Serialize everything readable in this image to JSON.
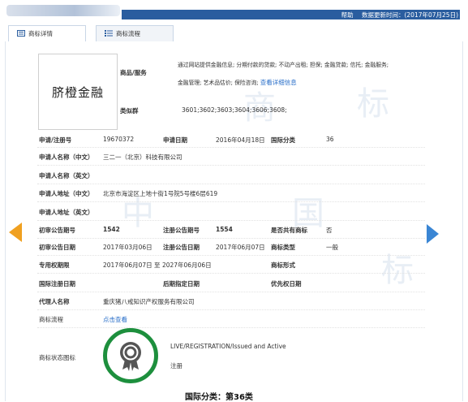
{
  "header": {
    "help_label": "帮助",
    "update_label": "数据更新时间：(2017年07月25日)"
  },
  "tabs": [
    {
      "label": "商标详情"
    },
    {
      "label": "商标流程"
    }
  ],
  "mark": {
    "image_text": "脐橙金融",
    "goods_label": "商品/服务",
    "goods_line1": "通过网站提供金融信息; 分期付款的贷款; 不动产出租; 担保; 金融贷款; 信托; 金融服务;",
    "goods_line2": "金融管理; 艺术品估价; 保险咨询;",
    "goods_link": "查看详细信息",
    "similar_label": "类似群",
    "similar_value": "3601;3602;3603;3604;3606;3608;"
  },
  "details": {
    "reg_no_label": "申请/注册号",
    "reg_no": "19670372",
    "apply_date_label": "申请日期",
    "apply_date": "2016年04月18日",
    "intl_class_label": "国际分类",
    "intl_class": "36",
    "applicant_cn_label": "申请人名称（中文）",
    "applicant_cn": "三二一（北京）科技有限公司",
    "applicant_en_label": "申请人名称（英文）",
    "address_cn_label": "申请人地址（中文）",
    "address_cn": "北京市海淀区上地十街1号院5号楼6层619",
    "address_en_label": "申请人地址（英文）",
    "prelim_no_label": "初审公告期号",
    "prelim_no": "1542",
    "reg_pub_no_label": "注册公告期号",
    "reg_pub_no": "1554",
    "shared_label": "是否共有商标",
    "shared": "否",
    "prelim_date_label": "初审公告日期",
    "prelim_date": "2017年03月06日",
    "reg_pub_date_label": "注册公告日期",
    "reg_pub_date": "2017年06月07日",
    "mark_type_label": "商标类型",
    "mark_type": "一般",
    "exclusive_label": "专用权期限",
    "exclusive": "2017年06月07日 至 2027年06月06日",
    "mark_form_label": "商标形式",
    "intl_reg_date_label": "国际注册日期",
    "later_date_label": "后期指定日期",
    "priority_date_label": "优先权日期",
    "agent_label": "代理人名称",
    "agent": "重庆猪八戒知识产权服务有限公司",
    "flow_label": "商标流程",
    "flow_link": "点击查看",
    "status_icon_label": "商标状态图标",
    "status_en": "LIVE/REGISTRATION/Issued and Active",
    "status_cn": "注册"
  },
  "footer": {
    "partial": "国际分类：第36类"
  },
  "colors": {
    "header_blue": "#2a5d9f",
    "link": "#2a6fc9",
    "prev_arrow": "#f0a020",
    "next_arrow": "#3a86d4",
    "badge_green": "#1d8f3d"
  },
  "icons": [
    "detail-icon",
    "flow-icon",
    "prev-arrow-icon",
    "next-arrow-icon",
    "registered-badge-icon"
  ]
}
